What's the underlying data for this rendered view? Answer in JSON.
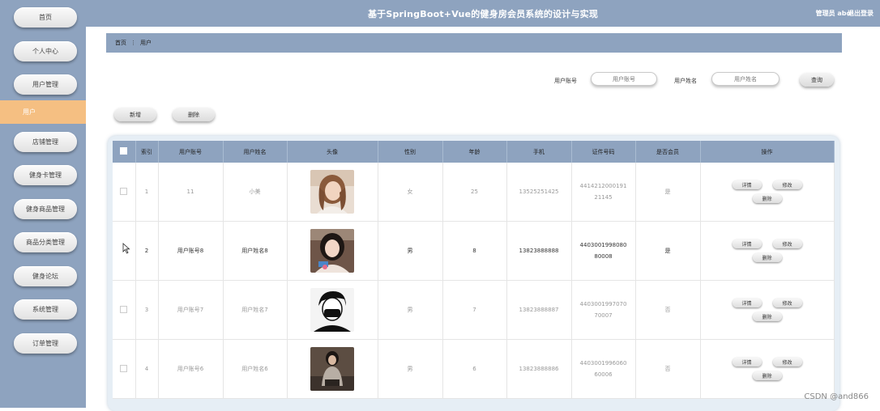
{
  "sidebar": {
    "items": [
      {
        "label": "首页"
      },
      {
        "label": "个人中心"
      },
      {
        "label": "用户管理"
      },
      {
        "label": "用户"
      },
      {
        "label": "店铺管理"
      },
      {
        "label": "健身卡管理"
      },
      {
        "label": "健身商品管理"
      },
      {
        "label": "商品分类管理"
      },
      {
        "label": "健身论坛"
      },
      {
        "label": "系统管理"
      },
      {
        "label": "订单管理"
      }
    ]
  },
  "header": {
    "title": "基于SpringBoot+Vue的健身房会员系统的设计与实现",
    "user": "管理员 abo",
    "logout": "退出登录"
  },
  "breadcrumb": {
    "home": "首页",
    "separator": "⋮",
    "current": "用户"
  },
  "search": {
    "account_label": "用户账号",
    "account_placeholder": "用户账号",
    "name_label": "用户姓名",
    "name_placeholder": "用户姓名",
    "query_button": "查询"
  },
  "actions": {
    "add": "新增",
    "delete": "删除"
  },
  "table": {
    "headers": [
      "索引",
      "用户账号",
      "用户姓名",
      "头像",
      "性别",
      "年龄",
      "手机",
      "证件号码",
      "是否会员",
      "操作"
    ],
    "op_labels": {
      "detail": "详情",
      "edit": "修改",
      "delete": "删除"
    },
    "rows": [
      {
        "index": "1",
        "account": "11",
        "name": "小美",
        "gender": "女",
        "age": "25",
        "phone": "13525251425",
        "id_number": "441421200019121145",
        "member": "是"
      },
      {
        "index": "2",
        "account": "用户账号8",
        "name": "用户姓名8",
        "gender": "男",
        "age": "8",
        "phone": "13823888888",
        "id_number": "440300199808080008",
        "member": "是"
      },
      {
        "index": "3",
        "account": "用户账号7",
        "name": "用户姓名7",
        "gender": "男",
        "age": "7",
        "phone": "13823888887",
        "id_number": "440300199707070007",
        "member": "否"
      },
      {
        "index": "4",
        "account": "用户账号6",
        "name": "用户姓名6",
        "gender": "男",
        "age": "6",
        "phone": "13823888886",
        "id_number": "440300199606060006",
        "member": "否"
      }
    ]
  },
  "watermark": "CSDN @and866",
  "colors": {
    "sidebar": "#8ea3bf",
    "active": "#f5bf82",
    "header": "#8ea3bf"
  }
}
